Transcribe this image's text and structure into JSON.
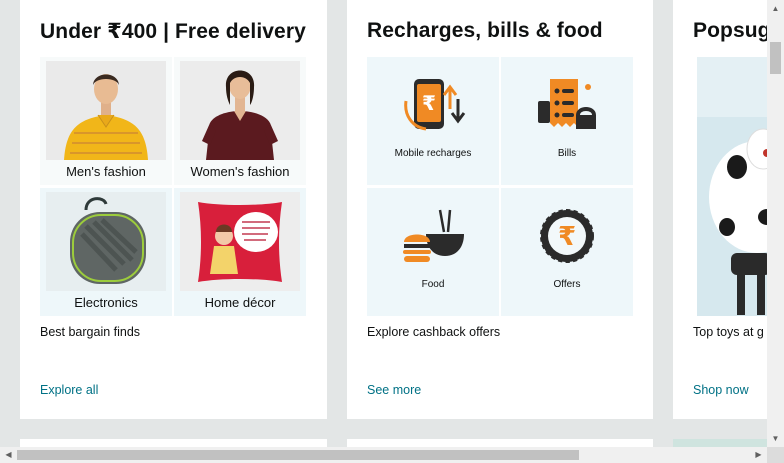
{
  "cards": [
    {
      "title": "Under ₹400 | Free delivery",
      "tiles": [
        {
          "label": "Men's fashion",
          "image": "man-in-yellow-polo"
        },
        {
          "label": "Women's fashion",
          "image": "woman-in-maroon-top"
        },
        {
          "label": "Electronics",
          "image": "earphone-case"
        },
        {
          "label": "Home décor",
          "image": "printed-cushion"
        }
      ],
      "description": "Best bargain finds",
      "link": "Explore all"
    },
    {
      "title": "Recharges, bills & food",
      "tiles": [
        {
          "label": "Mobile recharges",
          "icon": "mobile-recharge-icon"
        },
        {
          "label": "Bills",
          "icon": "bills-icon"
        },
        {
          "label": "Food",
          "icon": "food-icon"
        },
        {
          "label": "Offers",
          "icon": "offers-icon"
        }
      ],
      "description": "Explore cashback offers",
      "link": "See more"
    },
    {
      "title": "Popsug",
      "image": "robot-dog-toy",
      "description": "Top toys at g",
      "link": "Shop now"
    }
  ],
  "scrollbars": {
    "up_arrow": "▲",
    "down_arrow": "▼",
    "left_arrow": "◀",
    "right_arrow": "▶"
  },
  "colors": {
    "background": "#e3e6e6",
    "card": "#ffffff",
    "tile": "#f7fafa",
    "link": "#007185",
    "accent": "#f08a24"
  }
}
